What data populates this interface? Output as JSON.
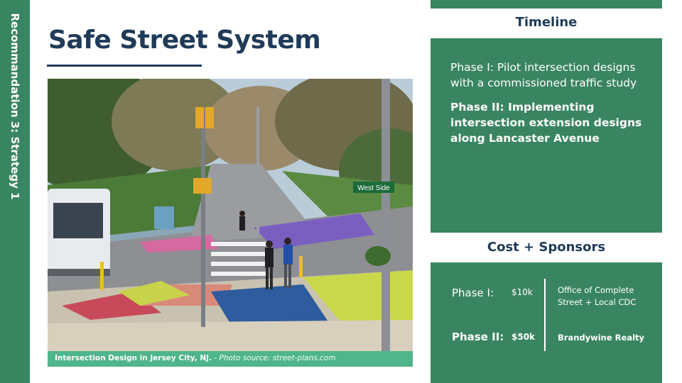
{
  "sidebar": {
    "label": "Recommandation 3: Strategy 1"
  },
  "header": {
    "title": "Safe Street System"
  },
  "photo": {
    "street_sign": "West Side",
    "caption_bold": "Intersection Design in  Jersey City, NJ.",
    "caption_italic": " - Photo source: street-plans.com"
  },
  "timeline": {
    "heading": "Timeline",
    "phase1": "Phase I: Pilot intersection designs with a commissioned traffic study",
    "phase2": "Phase II: Implementing intersection extension designs along Lancaster Avenue"
  },
  "cost": {
    "heading": "Cost + Sponsors",
    "rows": [
      {
        "phase": "Phase I:",
        "amount": "$10k",
        "sponsor": "Office of Complete Street + Local CDC"
      },
      {
        "phase": "Phase II:",
        "amount": "$50k",
        "sponsor": "Brandywine Realty"
      }
    ]
  },
  "colors": {
    "green": "#3a8561",
    "navy": "#1f3b59",
    "caption_green": "#4fb58a"
  }
}
